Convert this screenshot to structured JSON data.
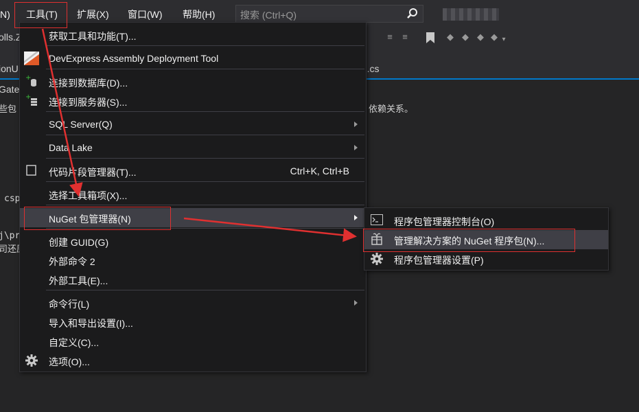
{
  "menubar": {
    "partial_left": "N)",
    "items": [
      "工具(T)",
      "扩展(X)",
      "窗口(W)",
      "帮助(H)"
    ],
    "search_placeholder": "搜索 (Ctrl+Q)"
  },
  "background": {
    "tab1": "olls.Z",
    "tab2": "ionU",
    "tab3": ").cs",
    "nav": "Gate",
    "line1_left": "些包",
    "line1_right": "依赖关系。",
    "line2": "csp",
    "line3": "j\\pr",
    "line4": "司还原"
  },
  "tools_menu": {
    "items": [
      {
        "label": "获取工具和功能(T)..."
      },
      {
        "label": "DevExpress Assembly Deployment Tool",
        "icon": "devexpress-icon"
      },
      {
        "label": "连接到数据库(D)...",
        "icon": "database-plus-icon"
      },
      {
        "label": "连接到服务器(S)...",
        "icon": "server-plus-icon"
      },
      {
        "label": "SQL Server(Q)",
        "submenu": true
      },
      {
        "label": "Data Lake",
        "submenu": true
      },
      {
        "label": "代码片段管理器(T)...",
        "shortcut": "Ctrl+K, Ctrl+B",
        "icon": "snippet-checkbox-icon"
      },
      {
        "label": "选择工具箱项(X)..."
      },
      {
        "label": "NuGet 包管理器(N)",
        "submenu": true,
        "highlighted": true
      },
      {
        "label": "创建 GUID(G)"
      },
      {
        "label": "外部命令 2"
      },
      {
        "label": "外部工具(E)..."
      },
      {
        "label": "命令行(L)",
        "submenu": true
      },
      {
        "label": "导入和导出设置(I)..."
      },
      {
        "label": "自定义(C)..."
      },
      {
        "label": "选项(O)...",
        "icon": "gear-icon"
      }
    ]
  },
  "nuget_submenu": {
    "items": [
      {
        "label": "程序包管理器控制台(O)",
        "icon": "console-icon"
      },
      {
        "label": "管理解决方案的 NuGet 程序包(N)...",
        "icon": "package-icon",
        "highlighted": true
      },
      {
        "label": "程序包管理器设置(P)",
        "icon": "gear-icon"
      }
    ]
  },
  "colors": {
    "menu_bg": "#1b1b1c",
    "highlight": "#3f3f46",
    "annotation_red": "#e03030",
    "accent": "#007acc"
  }
}
